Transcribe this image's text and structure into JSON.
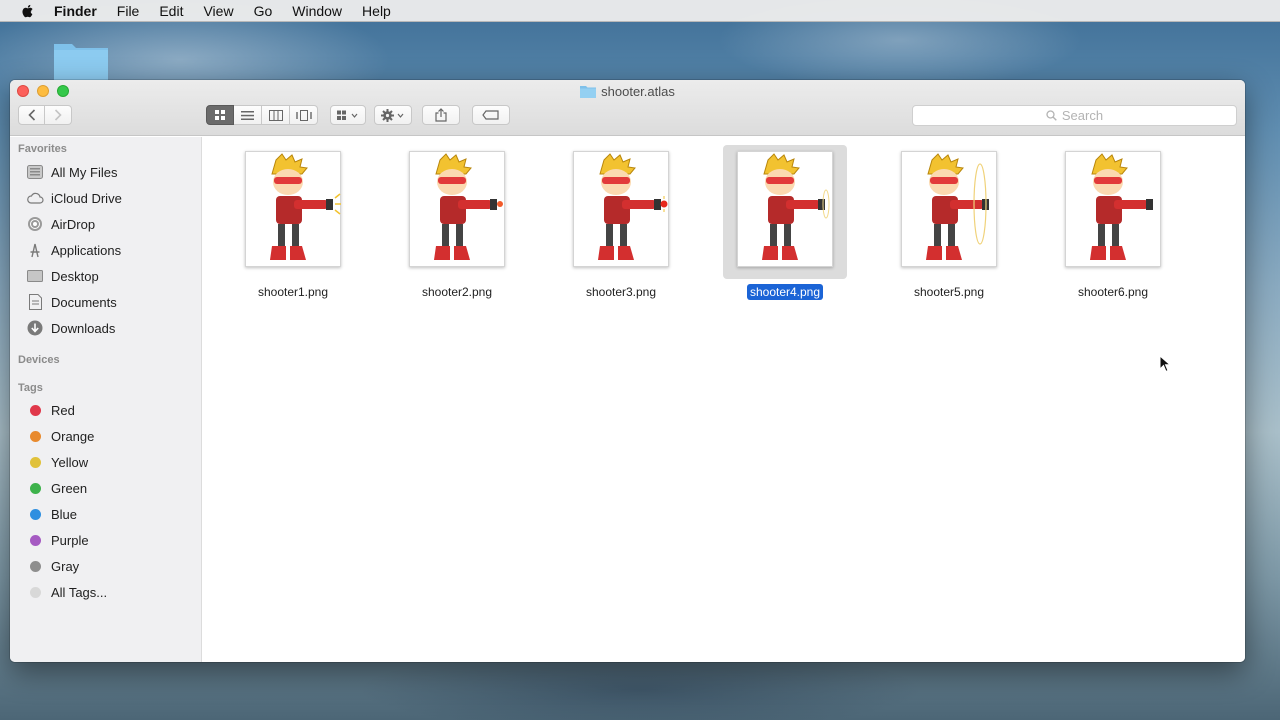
{
  "menubar": {
    "app_name": "Finder",
    "items": [
      "File",
      "Edit",
      "View",
      "Go",
      "Window",
      "Help"
    ]
  },
  "window": {
    "title": "shooter.atlas",
    "search_placeholder": "Search"
  },
  "sidebar": {
    "favorites_header": "Favorites",
    "favorites": [
      {
        "label": "All My Files",
        "icon": "all-files-icon"
      },
      {
        "label": "iCloud Drive",
        "icon": "cloud-icon"
      },
      {
        "label": "AirDrop",
        "icon": "airdrop-icon"
      },
      {
        "label": "Applications",
        "icon": "applications-icon"
      },
      {
        "label": "Desktop",
        "icon": "desktop-icon"
      },
      {
        "label": "Documents",
        "icon": "documents-icon"
      },
      {
        "label": "Downloads",
        "icon": "downloads-icon"
      }
    ],
    "devices_header": "Devices",
    "tags_header": "Tags",
    "tags": [
      {
        "label": "Red",
        "color": "#e0384a"
      },
      {
        "label": "Orange",
        "color": "#e88a2e"
      },
      {
        "label": "Yellow",
        "color": "#e0c13a"
      },
      {
        "label": "Green",
        "color": "#3db24b"
      },
      {
        "label": "Blue",
        "color": "#2f8fe0"
      },
      {
        "label": "Purple",
        "color": "#a55ac2"
      },
      {
        "label": "Gray",
        "color": "#8e8e8e"
      },
      {
        "label": "All Tags...",
        "color": "#d8d8d8"
      }
    ]
  },
  "files": [
    {
      "name": "shooter1.png",
      "selected": false
    },
    {
      "name": "shooter2.png",
      "selected": false
    },
    {
      "name": "shooter3.png",
      "selected": false
    },
    {
      "name": "shooter4.png",
      "selected": true
    },
    {
      "name": "shooter5.png",
      "selected": false
    },
    {
      "name": "shooter6.png",
      "selected": false
    }
  ]
}
